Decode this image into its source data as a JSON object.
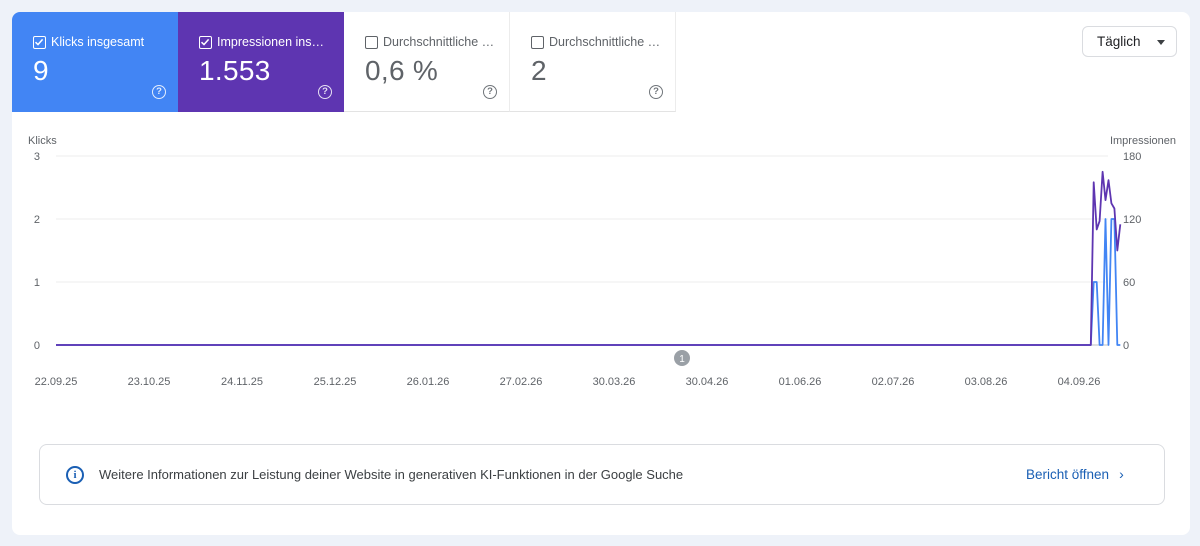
{
  "metrics": [
    {
      "label": "Klicks insgesamt",
      "value": "9",
      "checked": true,
      "color": "#4285f4"
    },
    {
      "label": "Impressionen ins…",
      "value": "1.553",
      "checked": true,
      "color": "#5e35b1"
    },
    {
      "label": "Durchschnittliche …",
      "value": "0,6 %",
      "checked": false
    },
    {
      "label": "Durchschnittliche …",
      "value": "2",
      "checked": false
    }
  ],
  "granularity": {
    "selected": "Täglich"
  },
  "chart_data": {
    "type": "line",
    "left_axis": {
      "title": "Klicks",
      "ticks": [
        "3",
        "2",
        "1",
        "0"
      ],
      "ylim": [
        0,
        3
      ]
    },
    "right_axis": {
      "title": "Impressionen",
      "ticks": [
        "180",
        "120",
        "60",
        "0"
      ],
      "ylim": [
        0,
        180
      ]
    },
    "x_ticks": [
      "22.09.25",
      "23.10.25",
      "24.11.25",
      "25.12.25",
      "26.01.26",
      "27.02.26",
      "30.03.26",
      "30.04.26",
      "01.06.26",
      "02.07.26",
      "03.08.26",
      "04.09.26"
    ],
    "annotation_badge": "1",
    "series": [
      {
        "axis": "left",
        "color": "#4285f4",
        "x": [
          "2026-09-08",
          "2026-09-09",
          "2026-09-10",
          "2026-09-11",
          "2026-09-12",
          "2026-09-13",
          "2026-09-14",
          "2026-09-15",
          "2026-09-16",
          "2026-09-17",
          "2026-09-18"
        ],
        "values": [
          0,
          1,
          1,
          0,
          0,
          2,
          0,
          2,
          2,
          0,
          0
        ]
      },
      {
        "axis": "right",
        "color": "#5e35b1",
        "x": [
          "2026-09-08",
          "2026-09-09",
          "2026-09-10",
          "2026-09-11",
          "2026-09-12",
          "2026-09-13",
          "2026-09-14",
          "2026-09-15",
          "2026-09-16",
          "2026-09-17",
          "2026-09-18"
        ],
        "values": [
          0,
          155,
          110,
          118,
          165,
          138,
          157,
          135,
          130,
          90,
          115
        ]
      }
    ]
  },
  "info": {
    "text": "Weitere Informationen zur Leistung deiner Website in generativen KI-Funktionen in der Google Suche",
    "link_label": "Bericht öffnen",
    "chevron": "›"
  }
}
